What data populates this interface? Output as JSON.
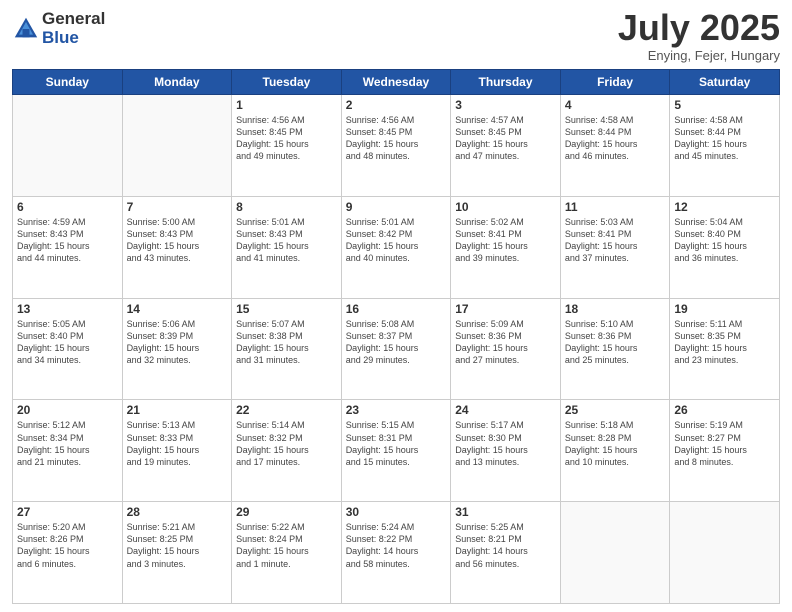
{
  "header": {
    "logo_general": "General",
    "logo_blue": "Blue",
    "month_title": "July 2025",
    "location": "Enying, Fejer, Hungary"
  },
  "weekdays": [
    "Sunday",
    "Monday",
    "Tuesday",
    "Wednesday",
    "Thursday",
    "Friday",
    "Saturday"
  ],
  "weeks": [
    [
      {
        "day": "",
        "info": ""
      },
      {
        "day": "",
        "info": ""
      },
      {
        "day": "1",
        "info": "Sunrise: 4:56 AM\nSunset: 8:45 PM\nDaylight: 15 hours\nand 49 minutes."
      },
      {
        "day": "2",
        "info": "Sunrise: 4:56 AM\nSunset: 8:45 PM\nDaylight: 15 hours\nand 48 minutes."
      },
      {
        "day": "3",
        "info": "Sunrise: 4:57 AM\nSunset: 8:45 PM\nDaylight: 15 hours\nand 47 minutes."
      },
      {
        "day": "4",
        "info": "Sunrise: 4:58 AM\nSunset: 8:44 PM\nDaylight: 15 hours\nand 46 minutes."
      },
      {
        "day": "5",
        "info": "Sunrise: 4:58 AM\nSunset: 8:44 PM\nDaylight: 15 hours\nand 45 minutes."
      }
    ],
    [
      {
        "day": "6",
        "info": "Sunrise: 4:59 AM\nSunset: 8:43 PM\nDaylight: 15 hours\nand 44 minutes."
      },
      {
        "day": "7",
        "info": "Sunrise: 5:00 AM\nSunset: 8:43 PM\nDaylight: 15 hours\nand 43 minutes."
      },
      {
        "day": "8",
        "info": "Sunrise: 5:01 AM\nSunset: 8:43 PM\nDaylight: 15 hours\nand 41 minutes."
      },
      {
        "day": "9",
        "info": "Sunrise: 5:01 AM\nSunset: 8:42 PM\nDaylight: 15 hours\nand 40 minutes."
      },
      {
        "day": "10",
        "info": "Sunrise: 5:02 AM\nSunset: 8:41 PM\nDaylight: 15 hours\nand 39 minutes."
      },
      {
        "day": "11",
        "info": "Sunrise: 5:03 AM\nSunset: 8:41 PM\nDaylight: 15 hours\nand 37 minutes."
      },
      {
        "day": "12",
        "info": "Sunrise: 5:04 AM\nSunset: 8:40 PM\nDaylight: 15 hours\nand 36 minutes."
      }
    ],
    [
      {
        "day": "13",
        "info": "Sunrise: 5:05 AM\nSunset: 8:40 PM\nDaylight: 15 hours\nand 34 minutes."
      },
      {
        "day": "14",
        "info": "Sunrise: 5:06 AM\nSunset: 8:39 PM\nDaylight: 15 hours\nand 32 minutes."
      },
      {
        "day": "15",
        "info": "Sunrise: 5:07 AM\nSunset: 8:38 PM\nDaylight: 15 hours\nand 31 minutes."
      },
      {
        "day": "16",
        "info": "Sunrise: 5:08 AM\nSunset: 8:37 PM\nDaylight: 15 hours\nand 29 minutes."
      },
      {
        "day": "17",
        "info": "Sunrise: 5:09 AM\nSunset: 8:36 PM\nDaylight: 15 hours\nand 27 minutes."
      },
      {
        "day": "18",
        "info": "Sunrise: 5:10 AM\nSunset: 8:36 PM\nDaylight: 15 hours\nand 25 minutes."
      },
      {
        "day": "19",
        "info": "Sunrise: 5:11 AM\nSunset: 8:35 PM\nDaylight: 15 hours\nand 23 minutes."
      }
    ],
    [
      {
        "day": "20",
        "info": "Sunrise: 5:12 AM\nSunset: 8:34 PM\nDaylight: 15 hours\nand 21 minutes."
      },
      {
        "day": "21",
        "info": "Sunrise: 5:13 AM\nSunset: 8:33 PM\nDaylight: 15 hours\nand 19 minutes."
      },
      {
        "day": "22",
        "info": "Sunrise: 5:14 AM\nSunset: 8:32 PM\nDaylight: 15 hours\nand 17 minutes."
      },
      {
        "day": "23",
        "info": "Sunrise: 5:15 AM\nSunset: 8:31 PM\nDaylight: 15 hours\nand 15 minutes."
      },
      {
        "day": "24",
        "info": "Sunrise: 5:17 AM\nSunset: 8:30 PM\nDaylight: 15 hours\nand 13 minutes."
      },
      {
        "day": "25",
        "info": "Sunrise: 5:18 AM\nSunset: 8:28 PM\nDaylight: 15 hours\nand 10 minutes."
      },
      {
        "day": "26",
        "info": "Sunrise: 5:19 AM\nSunset: 8:27 PM\nDaylight: 15 hours\nand 8 minutes."
      }
    ],
    [
      {
        "day": "27",
        "info": "Sunrise: 5:20 AM\nSunset: 8:26 PM\nDaylight: 15 hours\nand 6 minutes."
      },
      {
        "day": "28",
        "info": "Sunrise: 5:21 AM\nSunset: 8:25 PM\nDaylight: 15 hours\nand 3 minutes."
      },
      {
        "day": "29",
        "info": "Sunrise: 5:22 AM\nSunset: 8:24 PM\nDaylight: 15 hours\nand 1 minute."
      },
      {
        "day": "30",
        "info": "Sunrise: 5:24 AM\nSunset: 8:22 PM\nDaylight: 14 hours\nand 58 minutes."
      },
      {
        "day": "31",
        "info": "Sunrise: 5:25 AM\nSunset: 8:21 PM\nDaylight: 14 hours\nand 56 minutes."
      },
      {
        "day": "",
        "info": ""
      },
      {
        "day": "",
        "info": ""
      }
    ]
  ]
}
